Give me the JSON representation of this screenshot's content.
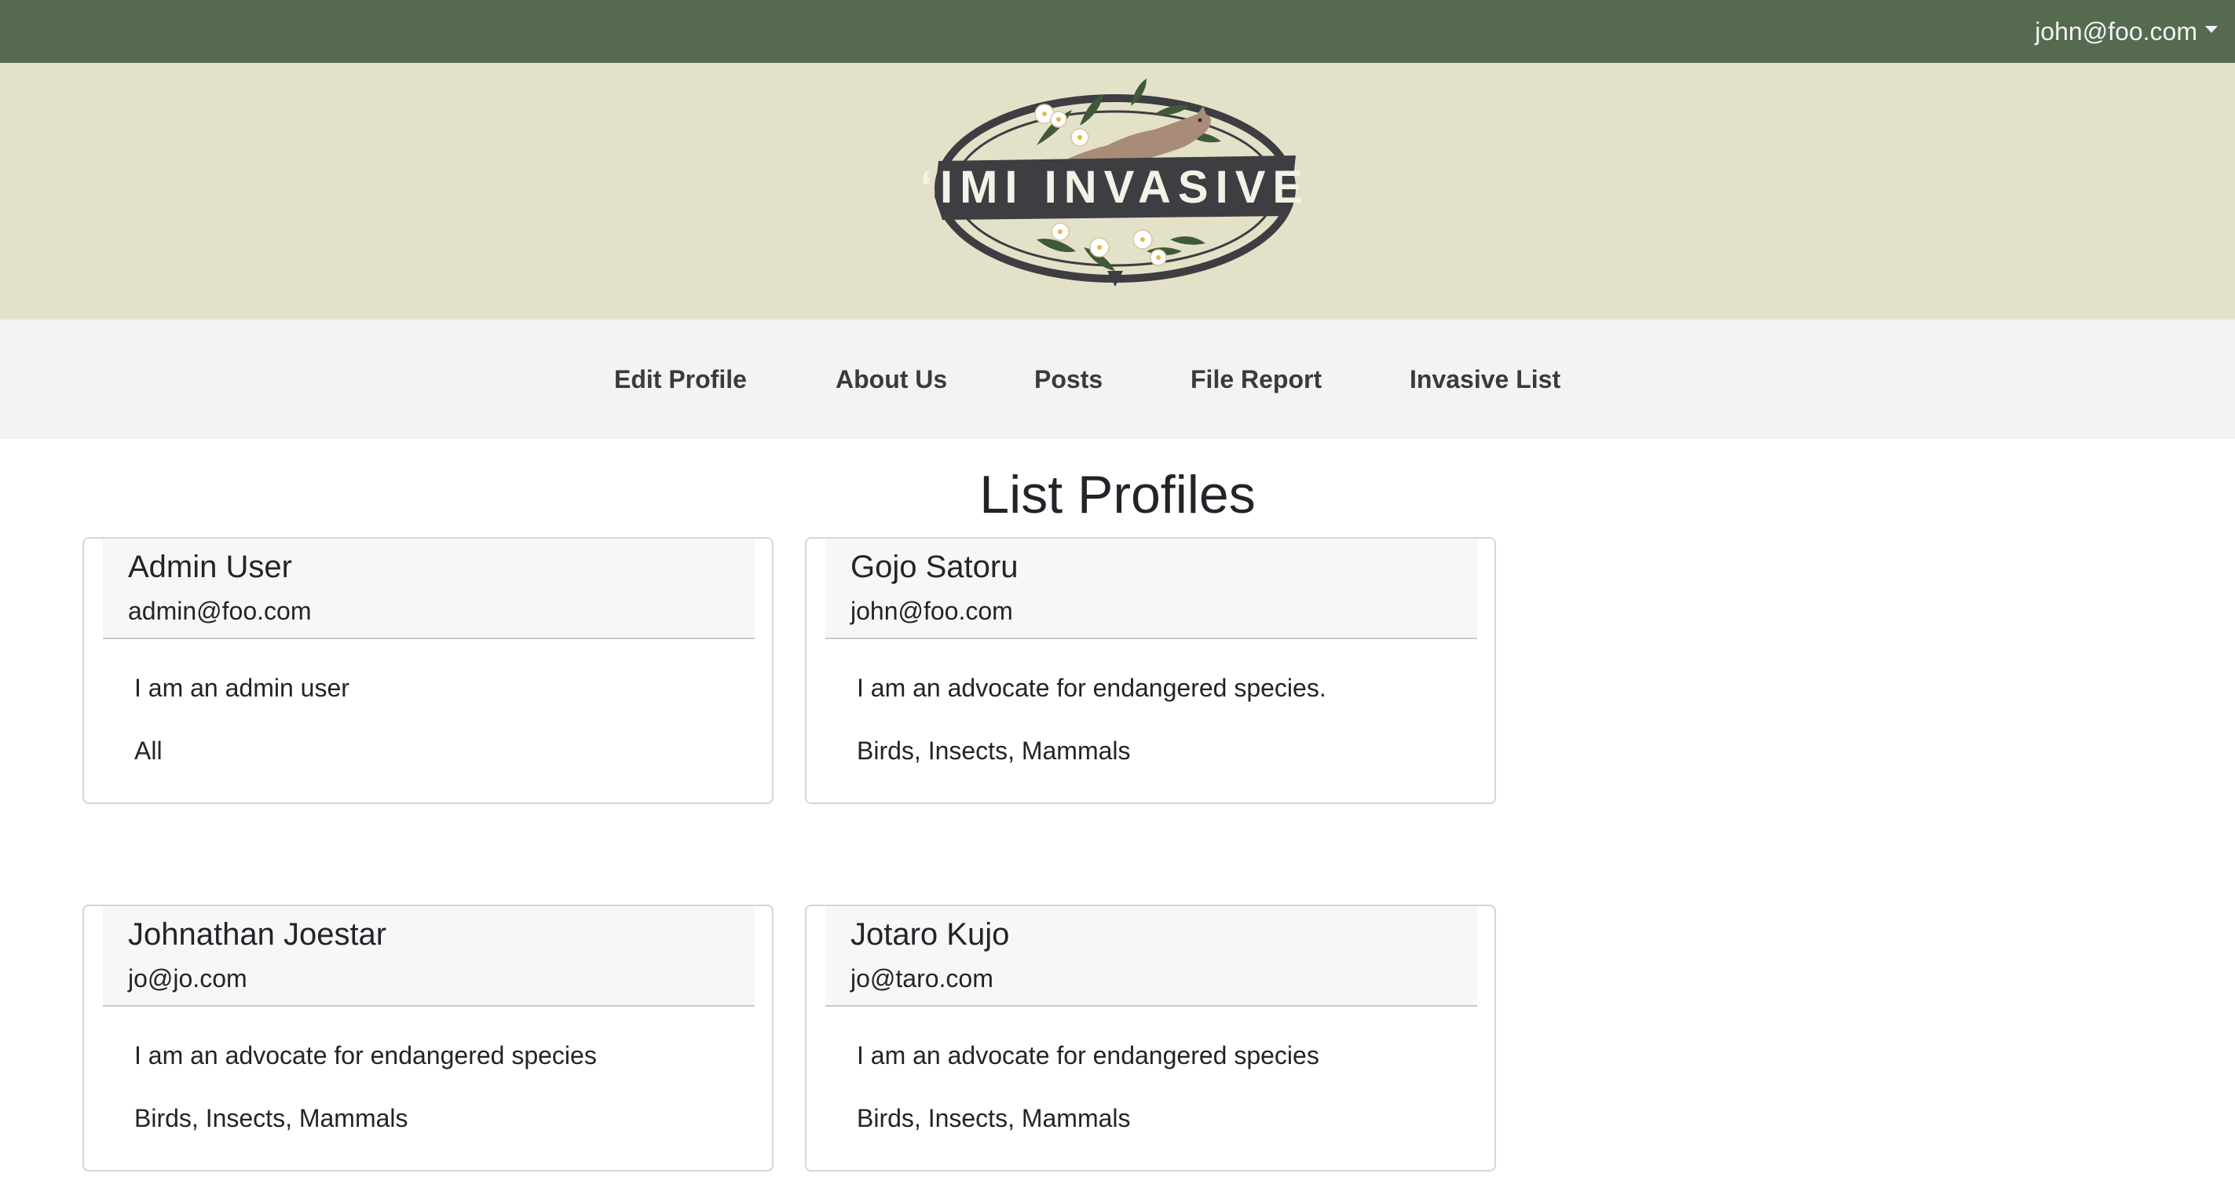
{
  "header": {
    "user_email": "john@foo.com"
  },
  "logo": {
    "text": "‘IMI INVASIVE"
  },
  "nav": {
    "items": [
      {
        "label": "Edit Profile"
      },
      {
        "label": "About Us"
      },
      {
        "label": "Posts"
      },
      {
        "label": "File Report"
      },
      {
        "label": "Invasive List"
      }
    ]
  },
  "page": {
    "title": "List Profiles"
  },
  "profiles": [
    {
      "name": "Admin User",
      "email": "admin@foo.com",
      "bio": "I am an admin user",
      "interests": "All"
    },
    {
      "name": "Gojo Satoru",
      "email": "john@foo.com",
      "bio": "I am an advocate for endangered species.",
      "interests": "Birds, Insects, Mammals"
    },
    {
      "name": "Johnathan Joestar",
      "email": "jo@jo.com",
      "bio": "I am an advocate for endangered species",
      "interests": "Birds, Insects, Mammals"
    },
    {
      "name": "Jotaro Kujo",
      "email": "jo@taro.com",
      "bio": "I am an advocate for endangered species",
      "interests": "Birds, Insects, Mammals"
    }
  ],
  "colors": {
    "topbar": "#566a4f",
    "banner": "#e4e1c9",
    "navbar": "#f3f3f3"
  }
}
